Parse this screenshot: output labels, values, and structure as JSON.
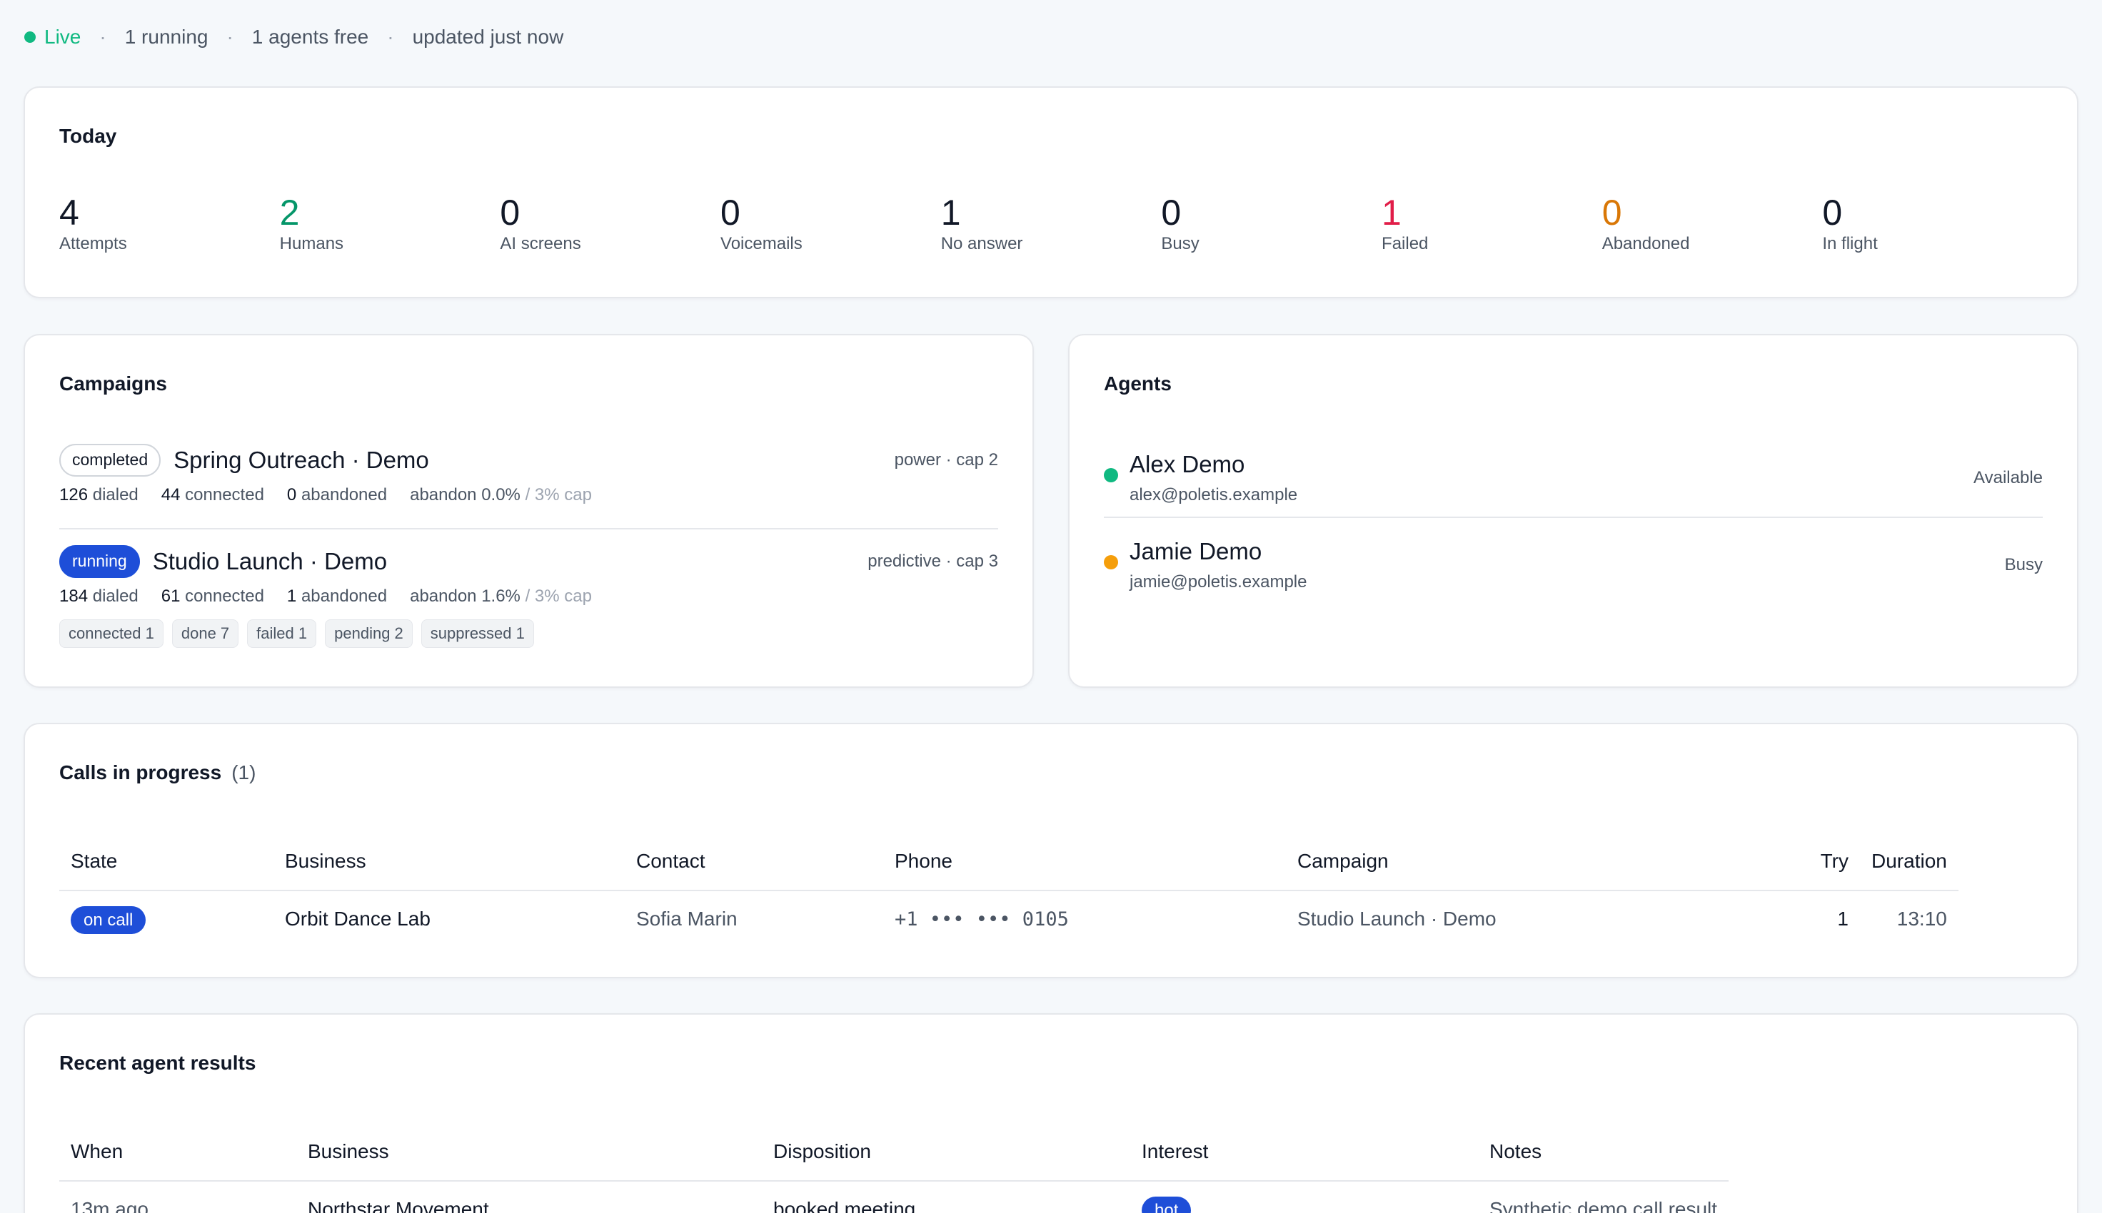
{
  "status": {
    "live": "Live",
    "running": "1 running",
    "agents_free": "1 agents free",
    "updated": "updated just now",
    "live_color": "#10b981"
  },
  "today": {
    "title": "Today",
    "stats": [
      {
        "value": "4",
        "label": "Attempts"
      },
      {
        "value": "2",
        "label": "Humans"
      },
      {
        "value": "0",
        "label": "AI screens"
      },
      {
        "value": "0",
        "label": "Voicemails"
      },
      {
        "value": "1",
        "label": "No answer"
      },
      {
        "value": "0",
        "label": "Busy"
      },
      {
        "value": "1",
        "label": "Failed"
      },
      {
        "value": "0",
        "label": "Abandoned"
      },
      {
        "value": "0",
        "label": "In flight"
      }
    ]
  },
  "campaigns": {
    "title": "Campaigns",
    "items": [
      {
        "status": "completed",
        "name": "Spring Outreach · Demo",
        "mode": "power · cap 2",
        "dialed_num": "126",
        "dialed_lbl": "dialed",
        "connected_num": "44",
        "connected_lbl": "connected",
        "abandoned_num": "0",
        "abandoned_lbl": "abandoned",
        "abandon_rate": "abandon 0.0%",
        "abandon_cap": "/ 3% cap"
      },
      {
        "status": "running",
        "name": "Studio Launch · Demo",
        "mode": "predictive · cap 3",
        "dialed_num": "184",
        "dialed_lbl": "dialed",
        "connected_num": "61",
        "connected_lbl": "connected",
        "abandoned_num": "1",
        "abandoned_lbl": "abandoned",
        "abandon_rate": "abandon 1.6%",
        "abandon_cap": "/ 3% cap",
        "tags": [
          "connected 1",
          "done 7",
          "failed 1",
          "pending 2",
          "suppressed 1"
        ]
      }
    ]
  },
  "agents": {
    "title": "Agents",
    "items": [
      {
        "name": "Alex Demo",
        "email": "alex@poletis.example",
        "status": "Available",
        "color": "#10b981"
      },
      {
        "name": "Jamie Demo",
        "email": "jamie@poletis.example",
        "status": "Busy",
        "color": "#f59e0b"
      }
    ]
  },
  "calls": {
    "title": "Calls in progress",
    "count": "(1)",
    "columns": [
      "State",
      "Business",
      "Contact",
      "Phone",
      "Campaign",
      "Try",
      "Duration"
    ],
    "rows": [
      {
        "state": "on call",
        "business": "Orbit Dance Lab",
        "contact": "Sofia Marin",
        "phone": "+1 ••• ••• 0105",
        "campaign": "Studio Launch · Demo",
        "try": "1",
        "duration": "13:10"
      }
    ]
  },
  "recent": {
    "title": "Recent agent results",
    "columns": [
      "When",
      "Business",
      "Disposition",
      "Interest",
      "Notes"
    ],
    "rows": [
      {
        "when": "13m ago",
        "business": "Northstar Movement",
        "disposition": "booked meeting",
        "interest": "hot",
        "notes": "Synthetic demo call result"
      }
    ]
  },
  "colors": {
    "accent_blue": "#1e4ed8",
    "humans_green": "#059669",
    "failed_red": "#e11d48",
    "abandoned_orange": "#d97706"
  }
}
